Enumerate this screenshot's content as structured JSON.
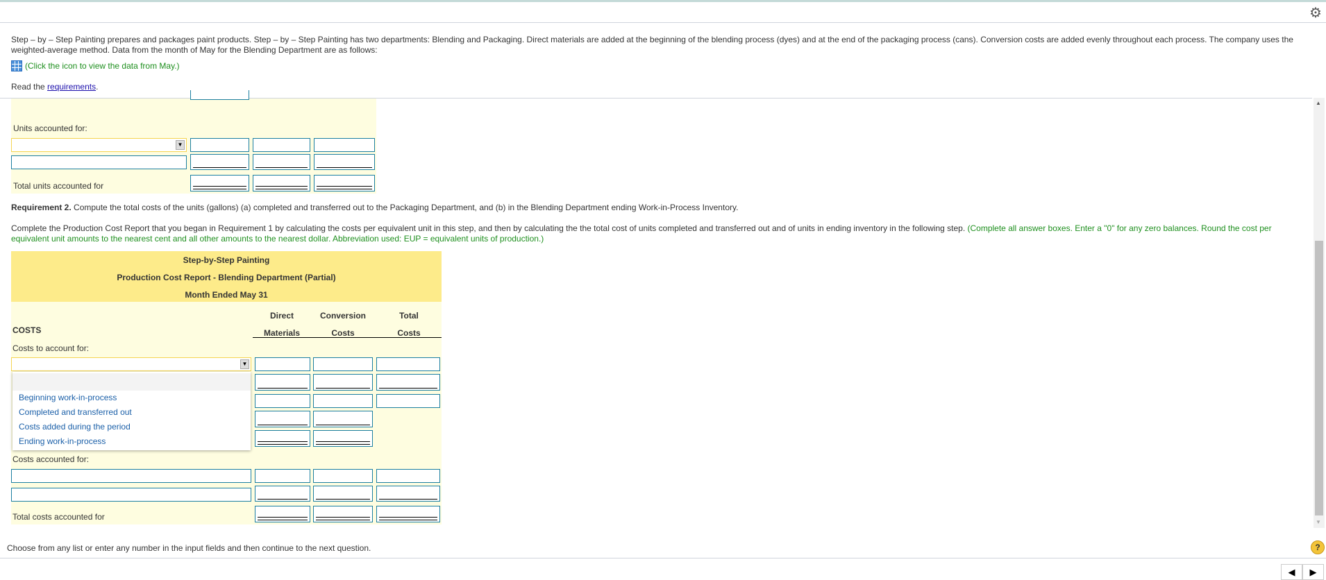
{
  "intro": {
    "text": "Step – by – Step Painting prepares and packages paint products. Step – by – Step Painting has two departments: Blending and Packaging. Direct materials are added at the beginning of the blending process (dyes) and at the end of the packaging process (cans). Conversion costs are added evenly throughout each process. The company uses the weighted-average method. Data from the month of May for the Blending Department are as follows:",
    "click_data": "(Click the icon to view the data from May.)",
    "read_prefix": "Read the ",
    "requirements_link": "requirements",
    "read_suffix": "."
  },
  "units": {
    "accounted_label": "Units accounted for:",
    "total_label": "Total units accounted for"
  },
  "req2": {
    "title": "Requirement 2.",
    "text": " Compute the total costs of the units (gallons) (a) completed and transferred out to the Packaging Department, and (b) in the Blending Department ending Work-in-Process Inventory.",
    "instructions": "Complete the Production Cost Report that you began in Requirement 1 by calculating the costs per equivalent unit in this step, and then by calculating the the total cost of units completed and transferred out and of units in ending inventory in the following step. ",
    "instructions_green": "(Complete all answer boxes. Enter a \"0\" for any zero balances. Round the cost per equivalent unit amounts to the nearest cent and all other amounts to the nearest dollar. Abbreviation used: EUP = equivalent units of production.)"
  },
  "report": {
    "company": "Step-by-Step Painting",
    "title": "Production Cost Report - Blending Department (Partial)",
    "period": "Month Ended May 31",
    "col1a": "Direct",
    "col1b": "Materials",
    "col2a": "Conversion",
    "col2b": "Costs",
    "col3a": "Total",
    "col3b": "Costs",
    "costs": "COSTS",
    "to_account": "Costs to account for:",
    "accounted": "Costs accounted for:",
    "total": "Total costs accounted for",
    "dropdown_options": [
      "Beginning work-in-process",
      "Completed and transferred out",
      "Costs added during the period",
      "Ending work-in-process"
    ]
  },
  "footer": {
    "text": "Choose from any list or enter any number in the input fields and then continue to the next question.",
    "help": "?"
  },
  "icons": {
    "settings": "gear-icon",
    "data": "table-icon",
    "help": "help-icon",
    "prev": "prev-arrow",
    "next": "next-arrow"
  },
  "colors": {
    "panel": "#fefde0",
    "header": "#fdeb8a",
    "input_border": "#1a7ea0",
    "green": "#1e8f1e"
  }
}
